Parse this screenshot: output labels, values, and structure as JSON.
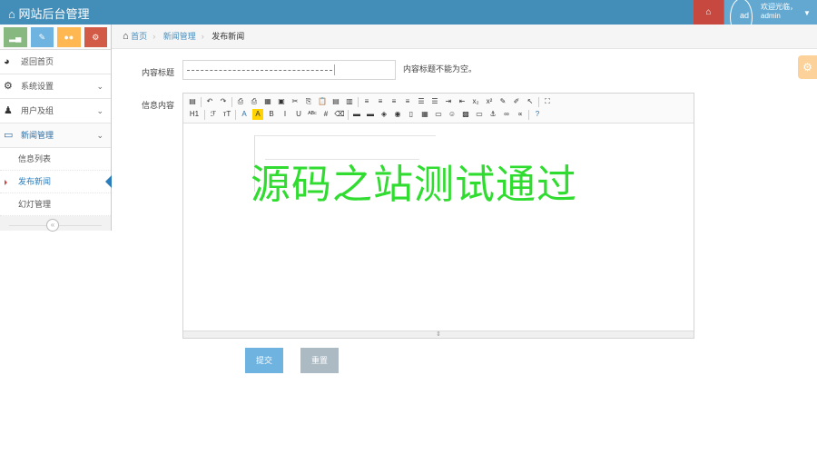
{
  "header": {
    "brand": "网站后台管理",
    "home_icon": "home-icon",
    "avatar_alt": "ad",
    "welcome": "欢迎光临，",
    "username": "admin"
  },
  "shortcuts": [
    {
      "icon": "signal-icon",
      "color": "#87b87f"
    },
    {
      "icon": "pencil-icon",
      "color": "#6fb3e0"
    },
    {
      "icon": "users-icon",
      "color": "#ffb752"
    },
    {
      "icon": "cogs-icon",
      "color": "#d15b47"
    }
  ],
  "sidebar": {
    "items": [
      {
        "label": "返回首页"
      },
      {
        "label": "系统设置"
      },
      {
        "label": "用户及组"
      },
      {
        "label": "新闻管理"
      }
    ],
    "subitems": [
      {
        "label": "信息列表"
      },
      {
        "label": "发布新闻"
      },
      {
        "label": "幻灯管理"
      }
    ],
    "collapse": "«"
  },
  "breadcrumb": {
    "home": "首页",
    "section": "新闻管理",
    "current": "发布新闻"
  },
  "form": {
    "title_label": "内容标题",
    "title_hint": "内容标题不能为空。",
    "content_label": "信息内容",
    "toolbar_h1": "H1",
    "watermark": "源码之站测试通过",
    "submit": "提交",
    "reset": "重置"
  }
}
